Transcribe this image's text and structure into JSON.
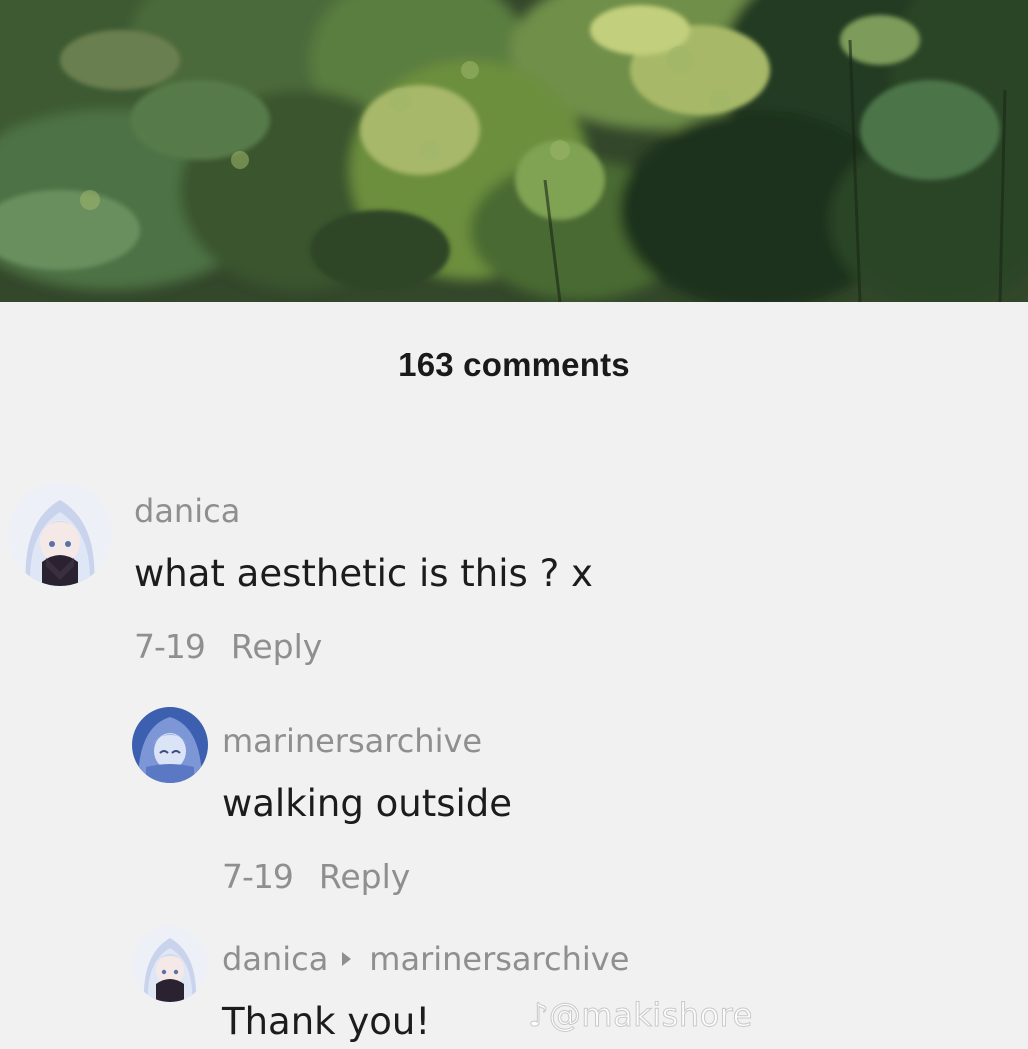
{
  "comments_header": {
    "count_label": "163 comments"
  },
  "comments": [
    {
      "username": "danica",
      "text": "what aesthetic is this ? x",
      "date": "7-19",
      "reply_label": "Reply"
    },
    {
      "username": "marinersarchive",
      "text": "walking outside",
      "date": "7-19",
      "reply_label": "Reply"
    },
    {
      "username": "danica",
      "reply_to": "marinersarchive",
      "text": "Thank you!"
    }
  ],
  "watermark": "@makishore",
  "colors": {
    "sheet_background": "#f1f1f1",
    "username": "#8f8f8f",
    "comment_text": "#1c1c1c",
    "count_text": "#1a1a1a"
  },
  "icons": {
    "reply_to_arrow": "play-triangle-icon",
    "watermark_logo": "tiktok-icon"
  }
}
